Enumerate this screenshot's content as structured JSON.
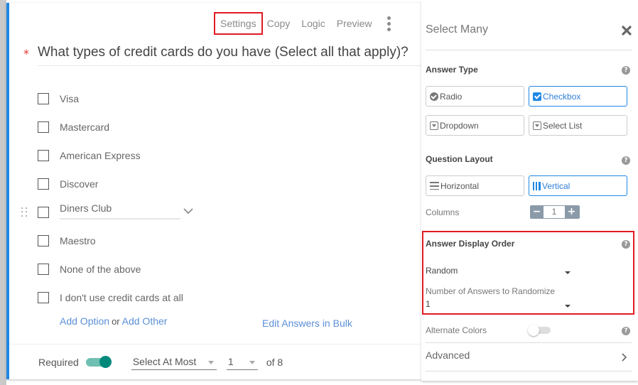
{
  "toolbar": {
    "items": [
      "Settings",
      "Copy",
      "Logic",
      "Preview"
    ],
    "highlighted": "Settings"
  },
  "question": {
    "required_marker": "*",
    "text": "What types of credit cards do you have (Select all that apply)?"
  },
  "options": [
    {
      "label": "Visa",
      "checked": false
    },
    {
      "label": "Mastercard",
      "checked": false
    },
    {
      "label": "American Express",
      "checked": false
    },
    {
      "label": "Discover",
      "checked": false
    },
    {
      "label": "Diners Club",
      "checked": false,
      "active": true
    },
    {
      "label": "Maestro",
      "checked": false
    },
    {
      "label": "None of the above",
      "checked": false
    },
    {
      "label": "I don't use credit cards at all",
      "checked": false
    }
  ],
  "add_row": {
    "add_option": "Add Option",
    "or": "or",
    "add_other": "Add Other"
  },
  "edit_bulk": "Edit Answers in Bulk",
  "footer": {
    "required_label": "Required",
    "required_on": true,
    "select_mode": "Select At Most",
    "select_count": "1",
    "of_label": "of 8"
  },
  "panel": {
    "title": "Select Many",
    "answer_type": {
      "heading": "Answer Type",
      "options": [
        {
          "label": "Radio",
          "icon": "radio-check-icon",
          "selected": false
        },
        {
          "label": "Checkbox",
          "icon": "checkbox-icon",
          "selected": true
        },
        {
          "label": "Dropdown",
          "icon": "dropdown-icon",
          "selected": false
        },
        {
          "label": "Select List",
          "icon": "select-list-icon",
          "selected": false
        }
      ]
    },
    "layout": {
      "heading": "Question Layout",
      "options": [
        {
          "label": "Horizontal",
          "icon": "horizontal-bars-icon",
          "selected": false
        },
        {
          "label": "Vertical",
          "icon": "vertical-bars-icon",
          "selected": true
        }
      ],
      "columns_label": "Columns",
      "columns_value": "1",
      "minus": "−",
      "plus": "+"
    },
    "display_order": {
      "heading": "Answer Display Order",
      "value": "Random",
      "randomize_label": "Number of Answers to Randomize",
      "randomize_value": "1"
    },
    "alternate_colors": {
      "label": "Alternate Colors",
      "on": false
    },
    "advanced": "Advanced",
    "help_glyph": "?"
  },
  "colors": {
    "accent": "#1e88e5",
    "highlight_box": "#e01b24",
    "toggle_on": "#00897b",
    "link": "#5b8fd6"
  }
}
